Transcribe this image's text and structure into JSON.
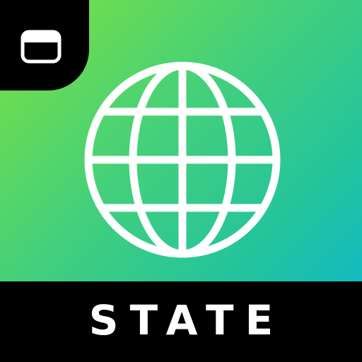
{
  "icon": {
    "label": "STATE",
    "corner_badge_icon": "browser-window-icon",
    "main_icon": "globe-icon",
    "colors": {
      "gradient_start": "#7de23e",
      "gradient_mid": "#23c49c",
      "gradient_end": "#0ab5d6",
      "badge_background": "#000000",
      "label_bar_background": "#000000",
      "foreground": "#ffffff"
    }
  }
}
